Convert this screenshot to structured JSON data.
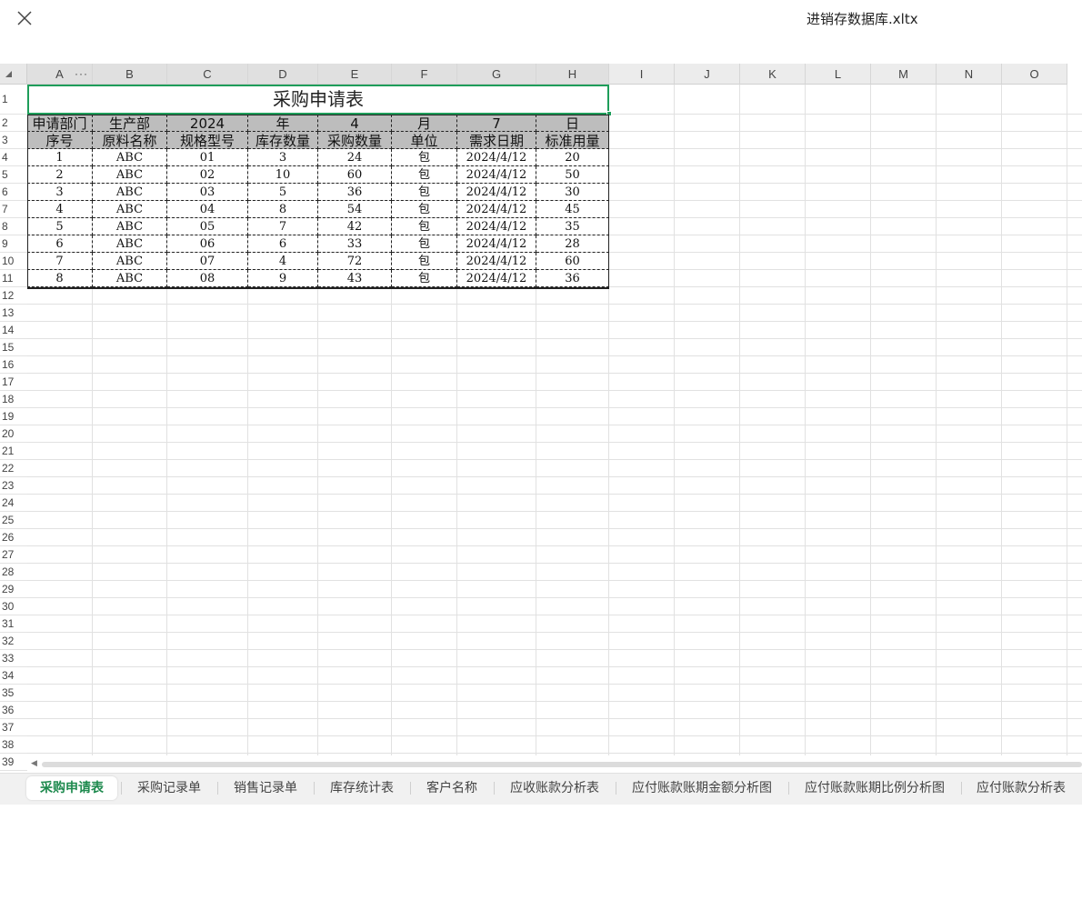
{
  "window": {
    "title": "进销存数据库.xltx",
    "close_icon": "close-icon"
  },
  "columns": [
    "A",
    "B",
    "C",
    "D",
    "E",
    "F",
    "G",
    "H",
    "I",
    "J",
    "K",
    "L",
    "M",
    "N",
    "O"
  ],
  "rows": [
    "1",
    "2",
    "3",
    "4",
    "5",
    "6",
    "7",
    "8",
    "9",
    "10",
    "11",
    "12",
    "13",
    "14",
    "15",
    "16",
    "17",
    "18",
    "19",
    "20",
    "21",
    "22",
    "23",
    "24",
    "25",
    "26",
    "27",
    "28",
    "29",
    "30",
    "31",
    "32",
    "33",
    "34",
    "35",
    "36",
    "37",
    "38",
    "39"
  ],
  "sheet": {
    "title": "采购申请表",
    "info_row": [
      "申请部门",
      "生产部",
      "2024",
      "年",
      "4",
      "月",
      "7",
      "日"
    ],
    "header_row": [
      "序号",
      "原料名称",
      "规格型号",
      "库存数量",
      "采购数量",
      "单位",
      "需求日期",
      "标准用量"
    ],
    "data": [
      [
        "1",
        "ABC",
        "01",
        "3",
        "24",
        "包",
        "2024/4/12",
        "20"
      ],
      [
        "2",
        "ABC",
        "02",
        "10",
        "60",
        "包",
        "2024/4/12",
        "50"
      ],
      [
        "3",
        "ABC",
        "03",
        "5",
        "36",
        "包",
        "2024/4/12",
        "30"
      ],
      [
        "4",
        "ABC",
        "04",
        "8",
        "54",
        "包",
        "2024/4/12",
        "45"
      ],
      [
        "5",
        "ABC",
        "05",
        "7",
        "42",
        "包",
        "2024/4/12",
        "35"
      ],
      [
        "6",
        "ABC",
        "06",
        "6",
        "33",
        "包",
        "2024/4/12",
        "28"
      ],
      [
        "7",
        "ABC",
        "07",
        "4",
        "72",
        "包",
        "2024/4/12",
        "60"
      ],
      [
        "8",
        "ABC",
        "08",
        "9",
        "43",
        "包",
        "2024/4/12",
        "36"
      ]
    ]
  },
  "tabs": [
    "采购申请表",
    "采购记录单",
    "销售记录单",
    "库存统计表",
    "客户名称",
    "应收账款分析表",
    "应付账款账期金额分析图",
    "应付账款账期比例分析图",
    "应付账款分析表"
  ],
  "active_tab": "采购申请表",
  "colors": {
    "accent": "#1e9d5a",
    "header_fill": "#bdbdbd"
  }
}
